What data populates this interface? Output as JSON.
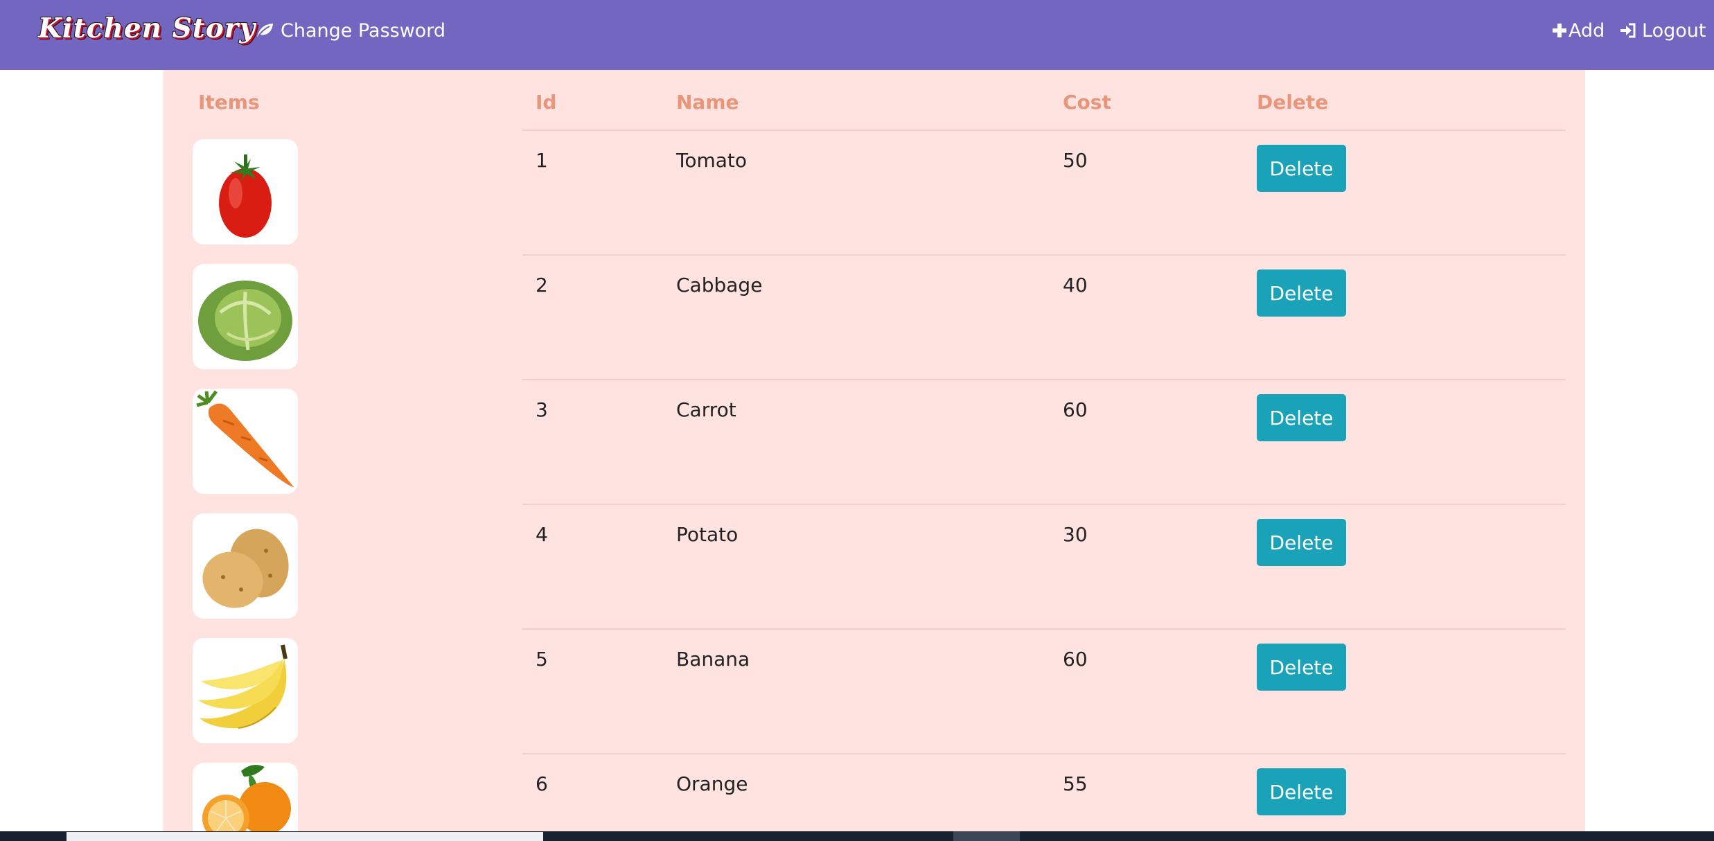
{
  "navbar": {
    "brand": "Kitchen Story",
    "change_password": "Change Password",
    "add": "Add",
    "logout": "Logout",
    "colors": {
      "background": "#7366c1",
      "text": "#ffffff"
    }
  },
  "table": {
    "headers": {
      "items": "Items",
      "id": "Id",
      "name": "Name",
      "cost": "Cost",
      "delete": "Delete"
    },
    "rows": [
      {
        "image": "tomato-image",
        "id": "1",
        "name": "Tomato",
        "cost": "50",
        "action": "Delete"
      },
      {
        "image": "cabbage-image",
        "id": "2",
        "name": "Cabbage",
        "cost": "40",
        "action": "Delete"
      },
      {
        "image": "carrot-image",
        "id": "3",
        "name": "Carrot",
        "cost": "60",
        "action": "Delete"
      },
      {
        "image": "potato-image",
        "id": "4",
        "name": "Potato",
        "cost": "30",
        "action": "Delete"
      },
      {
        "image": "banana-image",
        "id": "5",
        "name": "Banana",
        "cost": "60",
        "action": "Delete"
      },
      {
        "image": "orange-image",
        "id": "6",
        "name": "Orange",
        "cost": "55",
        "action": "Delete"
      }
    ],
    "colors": {
      "panel": "#ffe3e1",
      "header_text": "#e8957a",
      "button": "#1aa3b8"
    }
  },
  "icons": {
    "change_password": "leaf-icon",
    "add": "plus-icon",
    "logout": "sign-in-icon"
  }
}
